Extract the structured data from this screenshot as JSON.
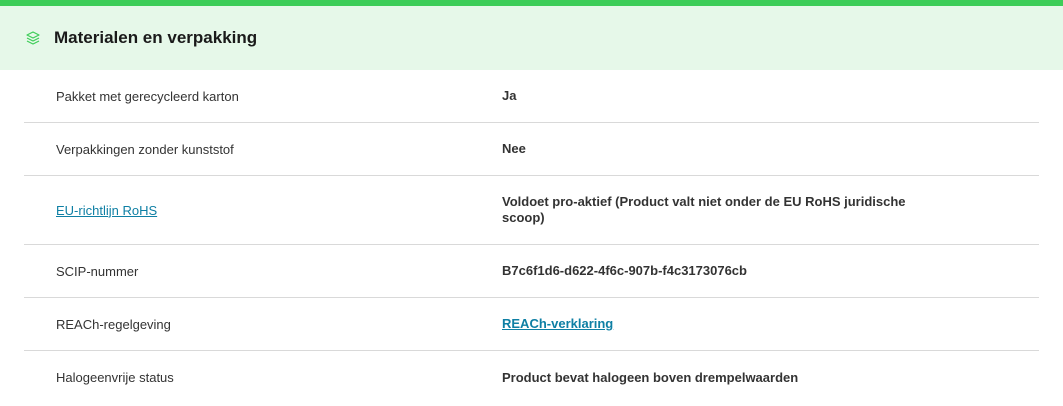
{
  "section": {
    "title": "Materialen en verpakking",
    "icon": "layers-icon",
    "accent_color": "#3dcd58",
    "header_bg": "#e6f8e9"
  },
  "rows": [
    {
      "label": "Pakket met gerecycleerd karton",
      "value": "Ja"
    },
    {
      "label": "Verpakkingen zonder kunststof",
      "value": "Nee"
    },
    {
      "label": "EU-richtlijn RoHS",
      "value": "Voldoet pro-aktief (Product valt niet onder de EU RoHS juridische scoop)"
    },
    {
      "label": "SCIP-nummer",
      "value": "B7c6f1d6-d622-4f6c-907b-f4c3173076cb"
    },
    {
      "label": "REACh-regelgeving",
      "value": "REACh-verklaring"
    },
    {
      "label": "Halogeenvrije status",
      "value": "Product bevat halogeen boven drempelwaarden"
    }
  ],
  "link_color": "#0e7fa4"
}
